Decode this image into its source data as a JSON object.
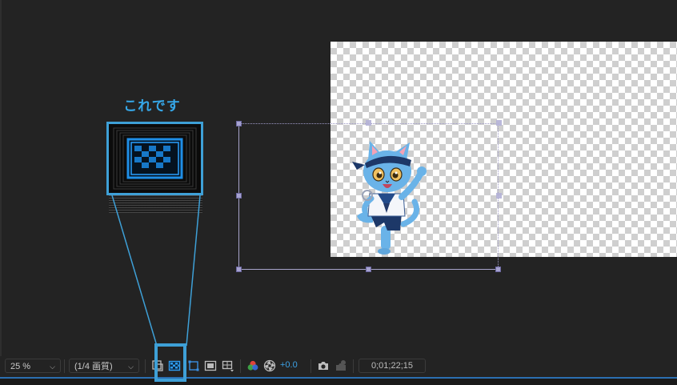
{
  "annotation": {
    "label": "これです",
    "accent_color": "#3ea0d7"
  },
  "toolbar": {
    "magnification": "25 %",
    "resolution": "(1/4 画質)",
    "exposure": "+0.0",
    "timecode": "0;01;22;15",
    "icons": [
      "region-of-interest-icon",
      "transparency-grid-icon",
      "mask-path-visibility-icon",
      "safe-margins-icon",
      "grid-guides-icon",
      "color-channels-icon",
      "color-management-icon",
      "snapshot-camera-icon",
      "show-snapshot-icon"
    ]
  }
}
